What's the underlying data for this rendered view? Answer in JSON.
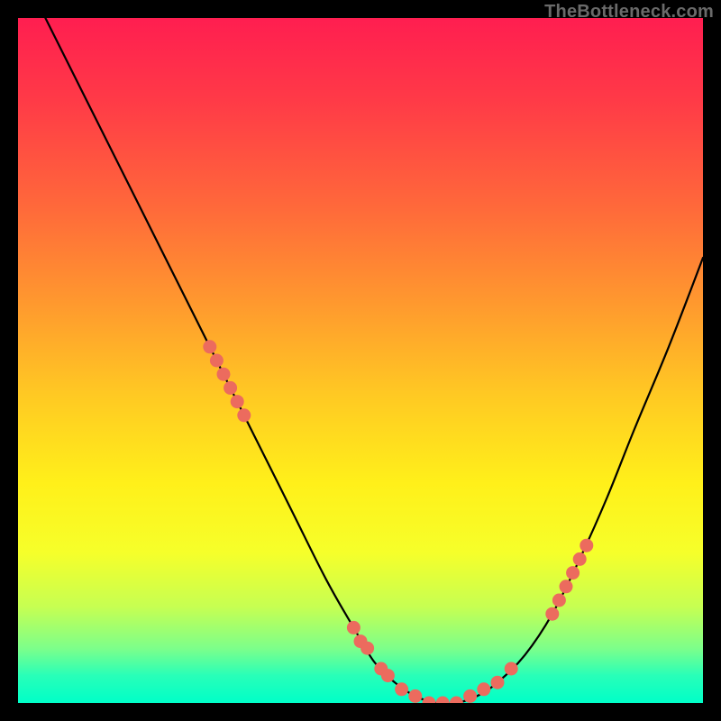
{
  "watermark": "TheBottleneck.com",
  "chart_data": {
    "type": "line",
    "title": "",
    "xlabel": "",
    "ylabel": "",
    "xlim": [
      0,
      100
    ],
    "ylim": [
      0,
      100
    ],
    "grid": false,
    "legend": false,
    "series": [
      {
        "name": "curve",
        "x": [
          4,
          10,
          18,
          26,
          34,
          40,
          45,
          49,
          52,
          55,
          58,
          61,
          64,
          67,
          70,
          74,
          78,
          82,
          86,
          90,
          95,
          100
        ],
        "y": [
          100,
          88,
          72,
          56,
          40,
          28,
          18,
          11,
          6,
          3,
          1,
          0,
          0,
          1,
          3,
          7,
          13,
          21,
          30,
          40,
          52,
          65
        ]
      }
    ],
    "markers": [
      {
        "x": 28,
        "y": 52
      },
      {
        "x": 29,
        "y": 50
      },
      {
        "x": 30,
        "y": 48
      },
      {
        "x": 31,
        "y": 46
      },
      {
        "x": 32,
        "y": 44
      },
      {
        "x": 33,
        "y": 42
      },
      {
        "x": 49,
        "y": 11
      },
      {
        "x": 50,
        "y": 9
      },
      {
        "x": 51,
        "y": 8
      },
      {
        "x": 53,
        "y": 5
      },
      {
        "x": 54,
        "y": 4
      },
      {
        "x": 56,
        "y": 2
      },
      {
        "x": 58,
        "y": 1
      },
      {
        "x": 60,
        "y": 0
      },
      {
        "x": 62,
        "y": 0
      },
      {
        "x": 64,
        "y": 0
      },
      {
        "x": 66,
        "y": 1
      },
      {
        "x": 68,
        "y": 2
      },
      {
        "x": 70,
        "y": 3
      },
      {
        "x": 72,
        "y": 5
      },
      {
        "x": 78,
        "y": 13
      },
      {
        "x": 79,
        "y": 15
      },
      {
        "x": 80,
        "y": 17
      },
      {
        "x": 81,
        "y": 19
      },
      {
        "x": 82,
        "y": 21
      },
      {
        "x": 83,
        "y": 23
      }
    ],
    "background_gradient": {
      "top": "#ff1e50",
      "mid": "#fff01a",
      "bottom": "#00ffc8"
    }
  }
}
